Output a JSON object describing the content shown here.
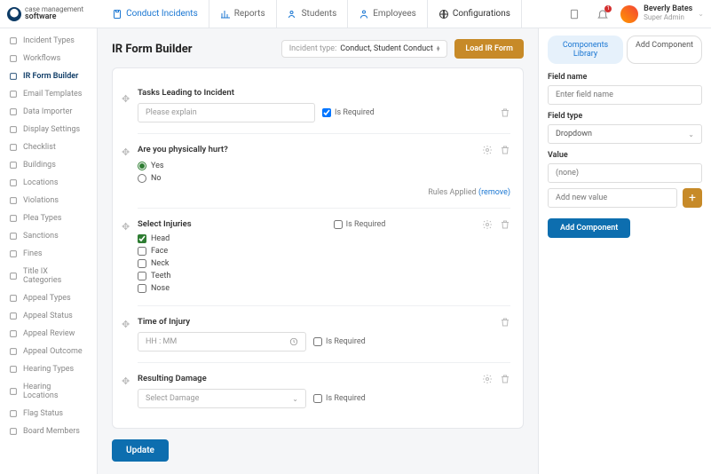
{
  "brand": {
    "line1": "case management",
    "line2": "software"
  },
  "nav": [
    {
      "label": "Conduct Incidents",
      "active": true
    },
    {
      "label": "Reports"
    },
    {
      "label": "Students"
    },
    {
      "label": "Employees"
    },
    {
      "label": "Configurations"
    }
  ],
  "notif_count": "1",
  "user": {
    "name": "Beverly Bates",
    "role": "Super Admin"
  },
  "sidebar": [
    "Incident Types",
    "Workflows",
    "IR Form Builder",
    "Email Templates",
    "Data Importer",
    "Display Settings",
    "Checklist",
    "Buildings",
    "Locations",
    "Violations",
    "Plea Types",
    "Sanctions",
    "Fines",
    "Title IX Categories",
    "Appeal Types",
    "Appeal Status",
    "Appeal Review",
    "Appeal Outcome",
    "Hearing Types",
    "Hearing Locations",
    "Flag Status",
    "Board Members"
  ],
  "sidebar_active": 2,
  "page": {
    "title": "IR Form Builder",
    "incident_type_label": "Incident type:",
    "incident_type_value": "Conduct, Student Conduct",
    "load_btn": "Load IR Form",
    "update_btn": "Update",
    "is_required": "Is Required",
    "rules_text": "Rules Applied ",
    "rules_remove": "(remove)"
  },
  "fields": {
    "tasks": {
      "label": "Tasks Leading to Incident",
      "placeholder": "Please explain",
      "required": true
    },
    "hurt": {
      "label": "Are you physically hurt?",
      "options": [
        "Yes",
        "No"
      ],
      "selected": "Yes"
    },
    "injuries": {
      "label": "Select Injuries",
      "options": [
        "Head",
        "Face",
        "Neck",
        "Teeth",
        "Nose"
      ],
      "checked": [
        "Head"
      ],
      "required": false
    },
    "time": {
      "label": "Time of Injury",
      "placeholder": "HH : MM",
      "required": false
    },
    "damage": {
      "label": "Resulting Damage",
      "placeholder": "Select Damage",
      "required": false
    }
  },
  "panel": {
    "tab1": "Components Library",
    "tab2": "Add Component",
    "field_name_label": "Field name",
    "field_name_ph": "Enter field name",
    "field_type_label": "Field type",
    "field_type_value": "Dropdown",
    "value_label": "Value",
    "value_ph": "(none)",
    "add_value_ph": "Add new value",
    "submit": "Add Component"
  }
}
